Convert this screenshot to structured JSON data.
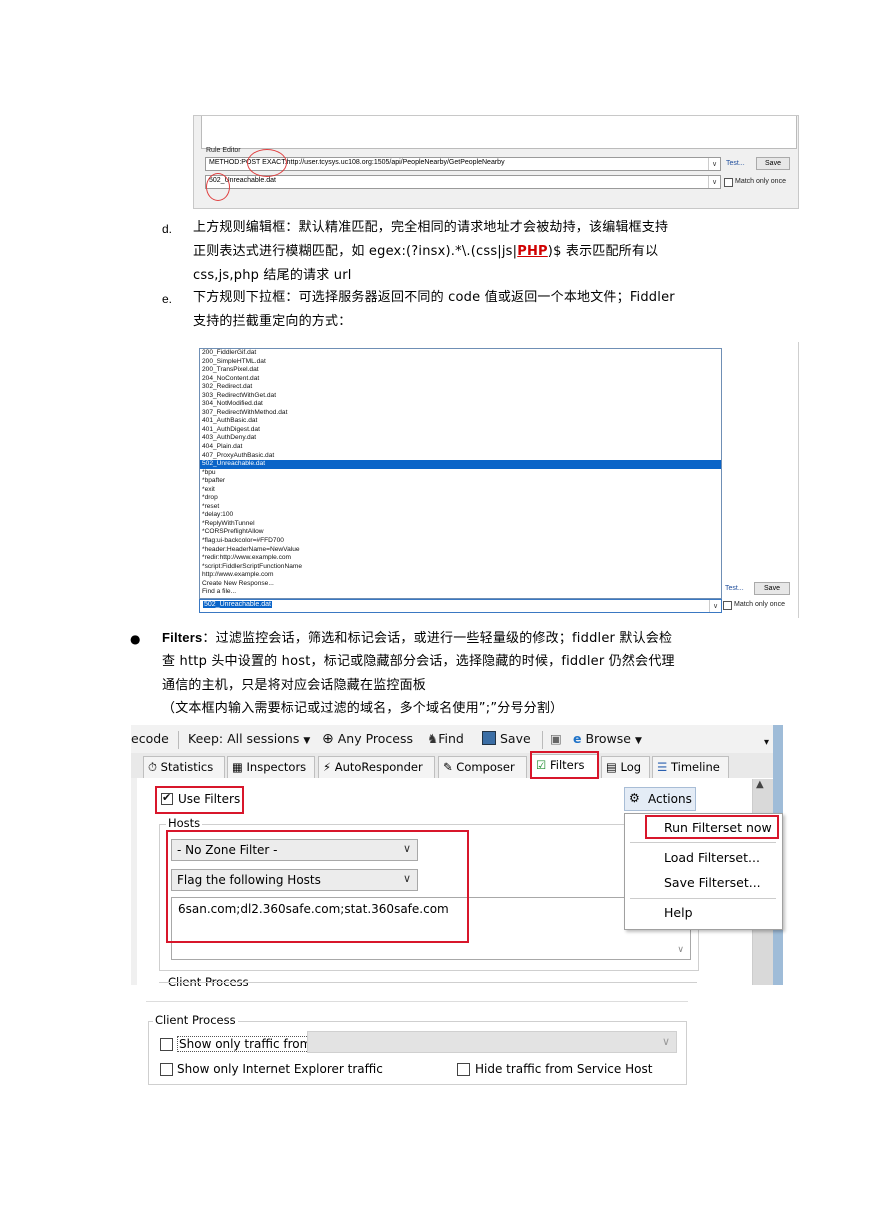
{
  "rule_editor": {
    "label": "Rule Editor",
    "match_value": "METHOD:POST EXACT:http://user.tcysys.uc108.org:1505/api/PeopleNearby/GetPeopleNearby",
    "response_value": "502_Unreachable.dat",
    "test_link": "Test...",
    "save_label": "Save",
    "match_once_label": "Match only once"
  },
  "doc": {
    "item_d_marker": "d.",
    "item_d_line1": "上方规则编辑框：默认精准匹配，完全相同的请求地址才会被劫持，该编辑框支持",
    "item_d_line2_a": "正则表达式进行模糊匹配，如 egex:(?insx).*\\.(css|js|",
    "item_d_line2_php": "PHP",
    "item_d_line2_b": ")$ 表示匹配所有以",
    "item_d_line3": "css,js,php 结尾的请求 url",
    "item_e_marker": "e.",
    "item_e_line1": "下方规则下拉框：可选择服务器返回不同的 code 值或返回一个本地文件；Fiddler",
    "item_e_line2": "支持的拦截重定向的方式：",
    "bullet_glyph": "●",
    "filters_title": "Filters",
    "filters_line1": "：过滤监控会话，筛选和标记会话，或进行一些轻量级的修改；fiddler 默认会检",
    "filters_line2": "查 http 头中设置的 host，标记或隐藏部分会话，选择隐藏的时候，fiddler 仍然会代理",
    "filters_line3": "通信的主机，只是将对应会话隐藏在监控面板",
    "filters_note": "（文本框内输入需要标记或过滤的域名，多个域名使用”;”分号分割）"
  },
  "dropdown_list": {
    "items": [
      "200_FiddlerGif.dat",
      "200_SimpleHTML.dat",
      "200_TransPixel.dat",
      "204_NoContent.dat",
      "302_Redirect.dat",
      "303_RedirectWithGet.dat",
      "304_NotModified.dat",
      "307_RedirectWithMethod.dat",
      "401_AuthBasic.dat",
      "401_AuthDigest.dat",
      "403_AuthDeny.dat",
      "404_Plain.dat",
      "407_ProxyAuthBasic.dat",
      "502_Unreachable.dat",
      "*bpu",
      "*bpafter",
      "*exit",
      "*drop",
      "*reset",
      "*delay:100",
      "*ReplyWithTunnel",
      "*CORSPreflightAllow",
      "*flag:ui-backcolor=#FFD700",
      "*header:HeaderName=NewValue",
      "*redir:http://www.example.com",
      "*script:FiddlerScriptFunctionName",
      "http://www.example.com",
      "Create New Response...",
      "Find a file..."
    ],
    "selected_index": 13,
    "current_value": "502_Unreachable.dat",
    "test_link": "Test...",
    "save_label": "Save",
    "match_once_label": "Match only once"
  },
  "fiddler": {
    "toolbar": {
      "decode_partial": "ecode",
      "keep": "Keep: All sessions",
      "any_process": "Any Process",
      "find": "Find",
      "save": "Save",
      "browse": "Browse"
    },
    "tabs": [
      "Statistics",
      "Inspectors",
      "AutoResponder",
      "Composer",
      "Filters",
      "Log",
      "Timeline"
    ],
    "active_tab": "Filters",
    "use_filters_label": "Use Filters",
    "use_filters_checked": true,
    "actions_label": "Actions",
    "hosts_group_label": "Hosts",
    "zone_filter_value": "- No Zone Filter -",
    "host_filter_value": "Flag the following Hosts",
    "hosts_text": "6san.com;dl2.360safe.com;stat.360safe.com",
    "client_process_label_cut": "Client Process",
    "menu": [
      "Run Filterset now",
      "Load Filterset...",
      "Save Filterset...",
      "Help"
    ]
  },
  "client_process": {
    "group_label": "Client Process",
    "show_only_traffic_from": "Show only traffic from",
    "show_only_ie": "Show only Internet Explorer traffic",
    "hide_service_host": "Hide traffic from Service Host"
  },
  "colors": {
    "highlight_red": "#d8162b",
    "selection_blue": "#0a64c8",
    "link_blue": "#1f4e9c"
  }
}
